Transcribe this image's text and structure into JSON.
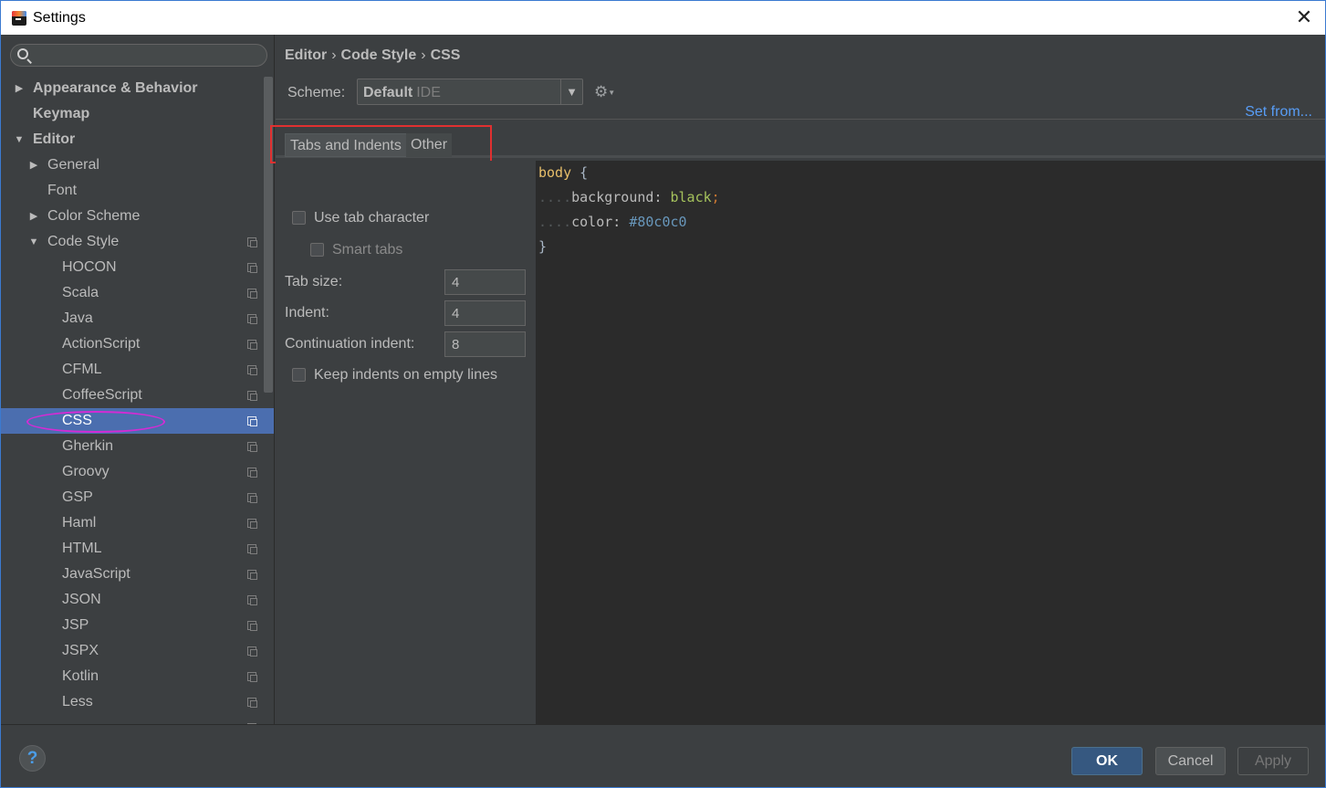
{
  "window": {
    "title": "Settings"
  },
  "search": {
    "placeholder": ""
  },
  "sidebar": {
    "items": [
      {
        "label": "Appearance & Behavior",
        "expanded": false
      },
      {
        "label": "Keymap"
      },
      {
        "label": "Editor",
        "expanded": true
      },
      {
        "label": "General",
        "expanded": false
      },
      {
        "label": "Font"
      },
      {
        "label": "Color Scheme",
        "expanded": false
      },
      {
        "label": "Code Style",
        "expanded": true
      },
      {
        "label": "HOCON"
      },
      {
        "label": "Scala"
      },
      {
        "label": "Java"
      },
      {
        "label": "ActionScript"
      },
      {
        "label": "CFML"
      },
      {
        "label": "CoffeeScript"
      },
      {
        "label": "CSS",
        "selected": true
      },
      {
        "label": "Gherkin"
      },
      {
        "label": "Groovy"
      },
      {
        "label": "GSP"
      },
      {
        "label": "Haml"
      },
      {
        "label": "HTML"
      },
      {
        "label": "JavaScript"
      },
      {
        "label": "JSON"
      },
      {
        "label": "JSP"
      },
      {
        "label": "JSPX"
      },
      {
        "label": "Kotlin"
      },
      {
        "label": "Less"
      }
    ]
  },
  "breadcrumb": {
    "part1": "Editor",
    "part2": "Code Style",
    "part3": "CSS",
    "separator": "›"
  },
  "scheme": {
    "label": "Scheme:",
    "value": "Default",
    "sub": "IDE"
  },
  "set_from": "Set from...",
  "tabs": {
    "tab1": "Tabs and Indents",
    "tab2": "Other",
    "active": "Tabs and Indents"
  },
  "options": {
    "use_tab_character": {
      "label": "Use tab character",
      "checked": false
    },
    "smart_tabs": {
      "label": "Smart tabs",
      "checked": false,
      "enabled": false
    },
    "tab_size": {
      "label": "Tab size:",
      "value": "4"
    },
    "indent": {
      "label": "Indent:",
      "value": "4"
    },
    "continuation_indent": {
      "label": "Continuation indent:",
      "value": "8"
    },
    "keep_indents": {
      "label": "Keep indents on empty lines",
      "checked": false
    }
  },
  "preview": {
    "selector": "body",
    "open_brace": "{",
    "close_brace": "}",
    "indent_dots": "....",
    "prop1": "background",
    "val1": "black",
    "prop2": "color",
    "val2": "#80c0c0",
    "colon": ":",
    "semicolon": ";"
  },
  "footer": {
    "help": "?",
    "ok": "OK",
    "cancel": "Cancel",
    "apply": "Apply"
  },
  "colors": {
    "background": "#3c3f41",
    "editor_background": "#2b2b2b",
    "selection": "#4b6eaf",
    "link": "#589df6",
    "highlight_box": "#e03030",
    "highlight_ellipse": "#d42bd4",
    "css_selector": "#e8bf6a",
    "css_value": "#a5c25c",
    "css_number": "#6897bb"
  }
}
